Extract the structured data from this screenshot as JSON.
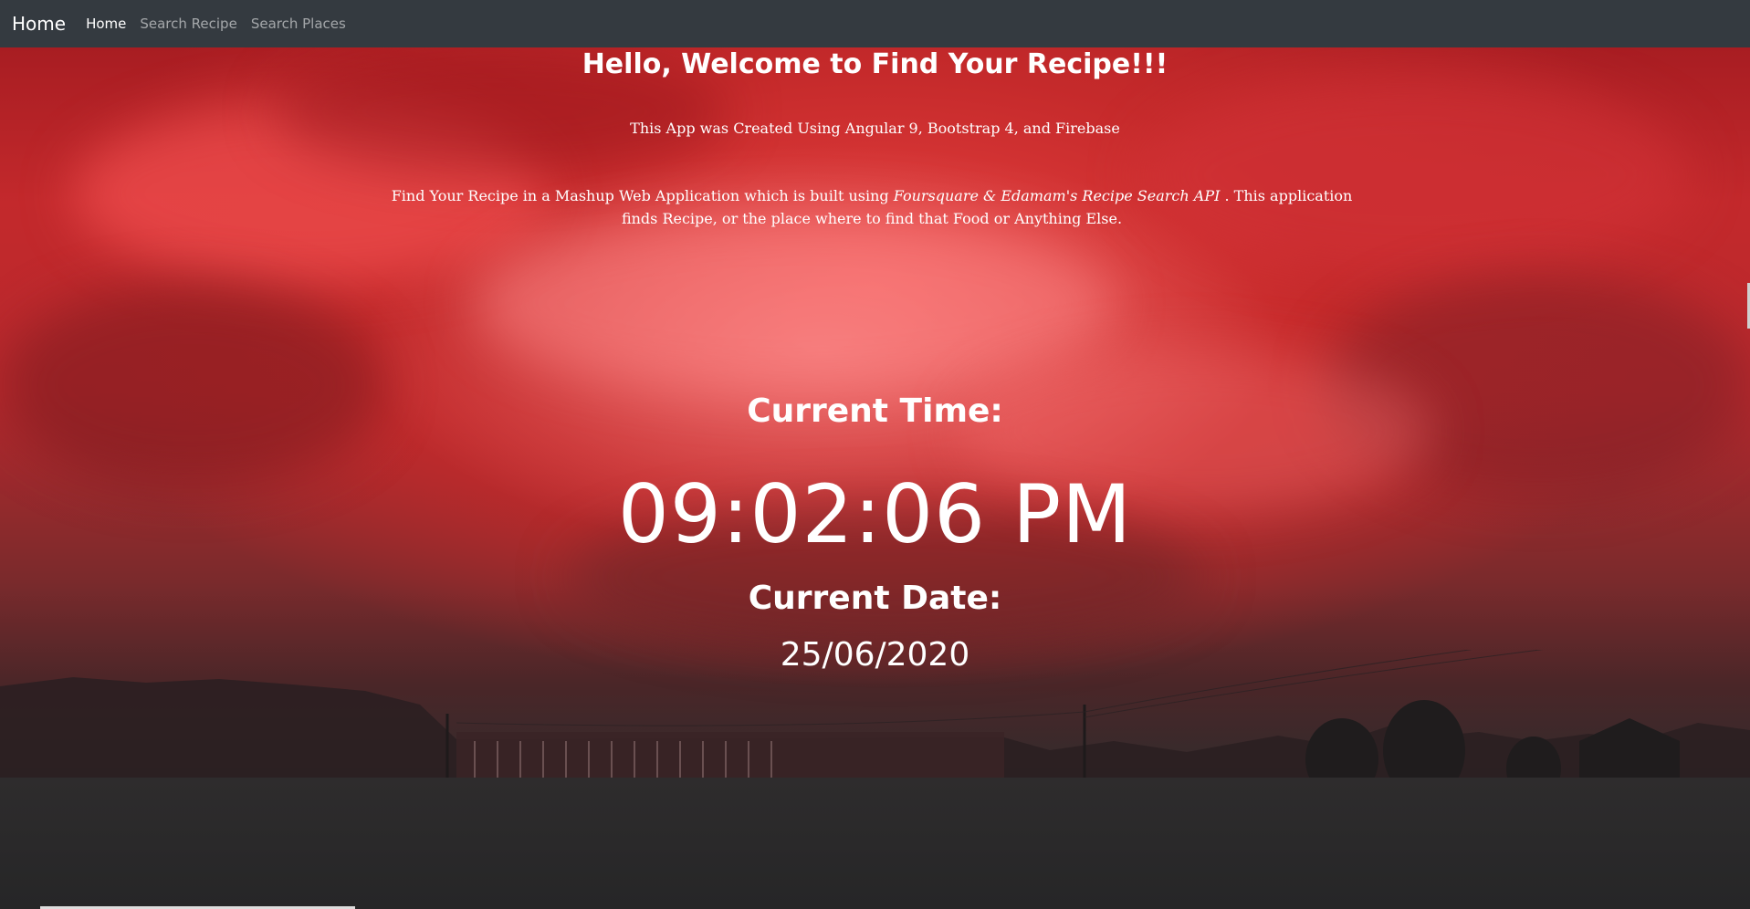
{
  "navbar": {
    "brand": "Home",
    "links": [
      {
        "label": "Home",
        "active": true
      },
      {
        "label": "Search Recipe",
        "active": false
      },
      {
        "label": "Search Places",
        "active": false
      }
    ]
  },
  "hero": {
    "welcome_prefix": "Hello, Welcome to ",
    "welcome_highlight": "Find Your Recipe!!!",
    "tech_line": "This App was Created Using Angular 9, Bootstrap 4, and Firebase",
    "description": {
      "before": "Find Your Recipe in a Mashup Web Application which is built using ",
      "emphasis": "Foursquare & Edamam's Recipe Search API",
      "after": " . This application finds Recipe, or the place where to find that Food or Anything Else."
    },
    "time_label": "Current Time:",
    "time_value": "09:02:06 PM",
    "date_label": "Current Date:",
    "date_value": "25/06/2020"
  },
  "colors": {
    "navbar_bg": "#343a40",
    "sky_red": "#e8403f",
    "text": "#ffffff"
  }
}
